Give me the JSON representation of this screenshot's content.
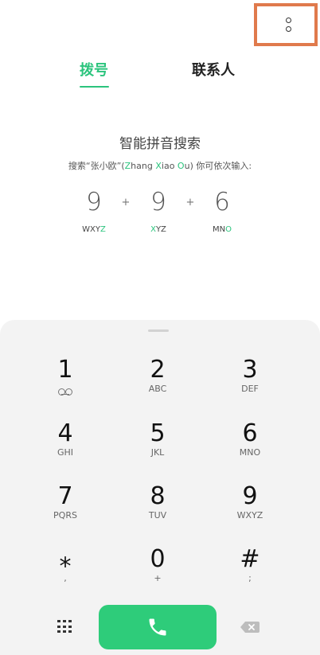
{
  "header": {
    "more_icon": "more-options-icon",
    "highlight_color": "#e07a4c"
  },
  "tabs": {
    "dial": "拨号",
    "contacts": "联系人",
    "active_color": "#2bc47d"
  },
  "hint": {
    "title": "智能拼音搜索",
    "sub_prefix": "搜索“张小欧”(",
    "z": "Z",
    "hang": "hang ",
    "x": "X",
    "iao": "iao ",
    "o": "O",
    "u": "u",
    "sub_suffix": ") 你可依次输入:"
  },
  "example": [
    {
      "digit": "9",
      "letters_plain": "WXY",
      "letters_hl": "Z",
      "letters_after": ""
    },
    {
      "digit": "9",
      "letters_plain": "",
      "letters_hl": "X",
      "letters_after": "YZ"
    },
    {
      "digit": "6",
      "letters_plain": "MN",
      "letters_hl": "O",
      "letters_after": ""
    }
  ],
  "plus": "+",
  "keys": [
    {
      "digit": "1",
      "sub": ""
    },
    {
      "digit": "2",
      "sub": "ABC"
    },
    {
      "digit": "3",
      "sub": "DEF"
    },
    {
      "digit": "4",
      "sub": "GHI"
    },
    {
      "digit": "5",
      "sub": "JKL"
    },
    {
      "digit": "6",
      "sub": "MNO"
    },
    {
      "digit": "7",
      "sub": "PQRS"
    },
    {
      "digit": "8",
      "sub": "TUV"
    },
    {
      "digit": "9",
      "sub": "WXYZ"
    },
    {
      "digit": "⁎",
      "sub": ","
    },
    {
      "digit": "0",
      "sub": "+"
    },
    {
      "digit": "#",
      "sub": ";"
    }
  ],
  "bottom": {
    "dialpad_icon": "dialpad-icon",
    "call_icon": "phone-icon",
    "call_color": "#2ecc7a",
    "backspace_icon": "backspace-icon"
  }
}
